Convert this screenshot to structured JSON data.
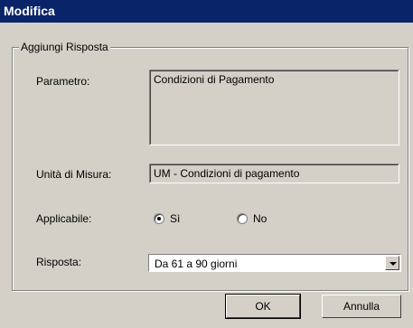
{
  "window": {
    "title": "Modifica"
  },
  "group": {
    "legend": "Aggiungi Risposta"
  },
  "fields": {
    "parametro": {
      "label": "Parametro:",
      "value": "Condizioni di Pagamento"
    },
    "unita": {
      "label": "Unità di Misura:",
      "value": "UM - Condizioni di pagamento"
    },
    "applicabile": {
      "label": "Applicabile:",
      "option_yes": "Sì",
      "option_no": "No",
      "selected": "Sì"
    },
    "risposta": {
      "label": "Risposta:",
      "value": "Da 61 a 90 giorni"
    }
  },
  "buttons": {
    "ok": "OK",
    "annulla": "Annulla"
  }
}
